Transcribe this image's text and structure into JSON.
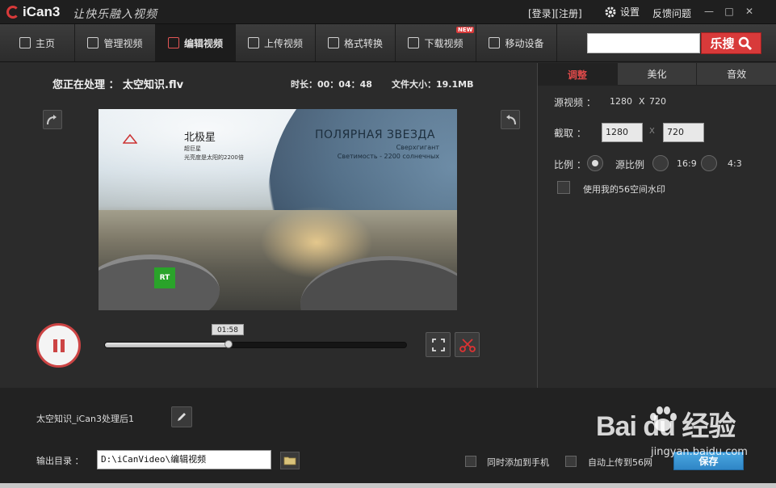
{
  "titlebar": {
    "app_name": "iCan3",
    "slogan": "让快乐融入视频",
    "login": "[登录][注册]",
    "settings": "设置",
    "feedback": "反馈问题",
    "minimize": "—",
    "maximize": "□",
    "close": "✕"
  },
  "nav": {
    "items": [
      {
        "label": "主页"
      },
      {
        "label": "管理视频"
      },
      {
        "label": "编辑视频"
      },
      {
        "label": "上传视频"
      },
      {
        "label": "格式转换"
      },
      {
        "label": "下载视频"
      },
      {
        "label": "移动设备"
      }
    ],
    "active": "编辑视频",
    "new_badge": "NEW",
    "search_placeholder": "",
    "search_button": "乐搜"
  },
  "player": {
    "processing_label": "您正在处理 ： 太空知识.flv",
    "duration": "时长：00：04：48",
    "filesize": "文件大小：19.1MB",
    "current_time": "01:58",
    "progress": 0.41,
    "video_text": {
      "cn_title": "北极星",
      "cn_line1": "超巨星",
      "cn_line2": "光亮度是太阳的2200倍",
      "ru_title": "ПОЛЯРНАЯ ЗВЕЗДА",
      "ru_line1": "Сверхгигант",
      "ru_line2": "Светимость - 2200 солнечных",
      "channel_logo": "RT"
    }
  },
  "right_panel": {
    "tabs": [
      {
        "label": "调整"
      },
      {
        "label": "美化"
      },
      {
        "label": "音效"
      }
    ],
    "active_tab": "调整",
    "source_label": "源视频 ：",
    "source_w": "1280",
    "source_x": "X",
    "source_h": "720",
    "crop_label": "截取 ：",
    "crop_w": "1280",
    "crop_x": "X",
    "crop_h": "720",
    "ratio_label": "比例 ：",
    "ratio_options": [
      {
        "label": "源比例",
        "checked": true
      },
      {
        "label": "16:9",
        "checked": false
      },
      {
        "label": "4:3",
        "checked": false
      }
    ],
    "watermark_checkbox": "使用我的56空间水印"
  },
  "bottom": {
    "output_name": "太空知识_iCan3处理后1",
    "output_dir_label": "输出目录 ：",
    "output_dir": "D:\\iCanVideo\\编辑视频",
    "add_to_phone": "同时添加到手机",
    "auto_upload": "自动上传到56网",
    "save": "保存"
  },
  "watermark": {
    "brand": "Bai du 经验",
    "url": "jingyan.baidu.com"
  },
  "colors": {
    "accent": "#d83a3a",
    "save": "#2f86c6",
    "background": "#2a2a2a"
  }
}
